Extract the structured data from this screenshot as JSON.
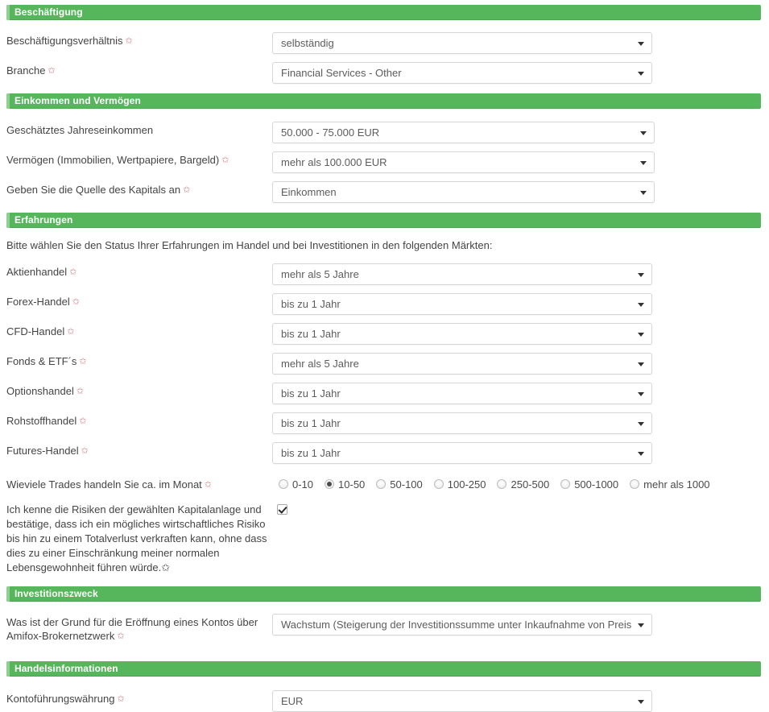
{
  "theme": {
    "section_header_bg": "#56b65b",
    "section_header_edge": "#8ed08d",
    "section_header_text": "#ffffff",
    "required_marker_color": "#d4767f",
    "label_text": "#444444",
    "field_text": "#5c5c5c",
    "field_border": "#d6d6d6",
    "page_bg": "#ffffff"
  },
  "required_marker": "✩",
  "sections": {
    "employment": {
      "title": "Beschäftigung",
      "rows": [
        {
          "label": "Beschäftigungsverhältnis",
          "required": true,
          "value": "selbständig"
        },
        {
          "label": "Branche",
          "required": true,
          "value": "Financial Services - Other"
        }
      ]
    },
    "income": {
      "title": "Einkommen und Vermögen",
      "rows": [
        {
          "label": "Geschätztes Jahreseinkommen",
          "required": false,
          "value": "50.000 - 75.000 EUR"
        },
        {
          "label": "Vermögen (Immobilien, Wertpapiere, Bargeld)",
          "required": true,
          "value": "mehr als 100.000 EUR"
        },
        {
          "label": "Geben Sie die Quelle des Kapitals an",
          "required": true,
          "value": "Einkommen"
        }
      ]
    },
    "experience": {
      "title": "Erfahrungen",
      "intro": "Bitte wählen Sie den Status Ihrer Erfahrungen im Handel und bei Investitionen in den folgenden Märkten:",
      "rows": [
        {
          "label": "Aktienhandel",
          "required": true,
          "value": "mehr als 5 Jahre"
        },
        {
          "label": "Forex-Handel",
          "required": true,
          "value": "bis zu 1 Jahr"
        },
        {
          "label": "CFD-Handel",
          "required": true,
          "value": "bis zu 1 Jahr"
        },
        {
          "label": "Fonds & ETF´s",
          "required": true,
          "value": "mehr als 5 Jahre"
        },
        {
          "label": "Optionshandel",
          "required": true,
          "value": "bis zu 1 Jahr"
        },
        {
          "label": "Rohstoffhandel",
          "required": true,
          "value": "bis zu 1 Jahr"
        },
        {
          "label": "Futures-Handel",
          "required": true,
          "value": "bis zu 1 Jahr"
        }
      ],
      "trades_per_month": {
        "label": "Wieviele Trades handeln Sie ca. im Monat",
        "required": true,
        "selected": "10-50",
        "options": [
          "0-10",
          "10-50",
          "50-100",
          "100-250",
          "250-500",
          "500-1000",
          "mehr als 1000"
        ]
      },
      "risk_consent": {
        "text": "Ich kenne die Risiken der gewählten Kapitalanlage und bestätige, dass ich ein mögliches wirtschaftliches Risiko bis hin zu einem Totalverlust verkraften kann, ohne dass dies zu einer Einschränkung meiner normalen Lebensgewohnheit führen würde.",
        "required": true,
        "checked": true
      }
    },
    "investment_purpose": {
      "title": "Investitionszweck",
      "rows": [
        {
          "label": "Was ist der Grund für die Eröffnung eines Kontos über Amifox-Brokernetzwerk",
          "required": true,
          "value": "Wachstum (Steigerung der Investitionssumme unter Inkaufnahme von Preis"
        }
      ]
    },
    "trading_information": {
      "title": "Handelsinformationen",
      "rows": [
        {
          "label": "Kontoführungswährung",
          "required": true,
          "value": "EUR"
        }
      ]
    }
  }
}
